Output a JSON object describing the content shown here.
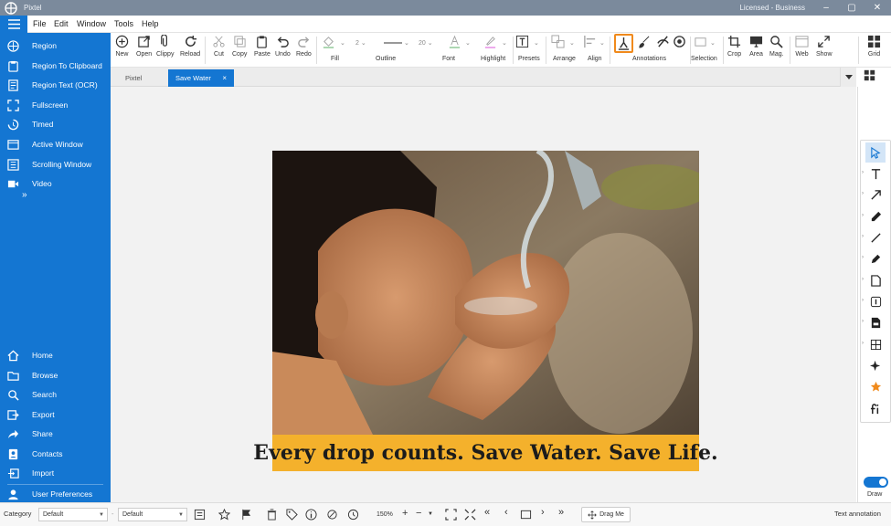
{
  "window": {
    "title": "Pixtel",
    "license": "Licensed - Business"
  },
  "menu": [
    "File",
    "Edit",
    "Window",
    "Tools",
    "Help"
  ],
  "sidebar": {
    "top": [
      {
        "label": "Region",
        "icon": "region-icon"
      },
      {
        "label": "Region To Clipboard",
        "icon": "clipboard-icon"
      },
      {
        "label": "Region Text (OCR)",
        "icon": "ocr-icon"
      },
      {
        "label": "Fullscreen",
        "icon": "fullscreen-icon"
      },
      {
        "label": "Timed",
        "icon": "timer-icon"
      },
      {
        "label": "Active Window",
        "icon": "window-icon"
      },
      {
        "label": "Scrolling Window",
        "icon": "scroll-window-icon"
      },
      {
        "label": "Video",
        "icon": "video-icon"
      }
    ],
    "more": "»",
    "bottom": [
      {
        "label": "Home",
        "icon": "home-icon"
      },
      {
        "label": "Browse",
        "icon": "folder-icon"
      },
      {
        "label": "Search",
        "icon": "search-icon"
      },
      {
        "label": "Export",
        "icon": "export-icon"
      },
      {
        "label": "Share",
        "icon": "share-icon"
      },
      {
        "label": "Contacts",
        "icon": "contacts-icon"
      },
      {
        "label": "Import",
        "icon": "import-icon"
      },
      {
        "label": "User Preferences",
        "icon": "user-icon"
      }
    ]
  },
  "toolbar": {
    "file": [
      "New",
      "Open",
      "Clippy",
      "Reload"
    ],
    "edit": [
      "Cut",
      "Copy",
      "Paste",
      "Undo",
      "Redo"
    ],
    "groups": {
      "fill": "Fill",
      "outline": "Outline",
      "font": "Font",
      "highlight": "Highlight",
      "presets": "Presets",
      "arrange": "Arrange",
      "align": "Align",
      "annotations": "Annotations",
      "selection": "Selection"
    },
    "outline_width": "2",
    "font_size": "20",
    "view": [
      "Crop",
      "Area",
      "Mag.",
      "Web",
      "Show",
      "Grid"
    ]
  },
  "tabs": [
    {
      "label": "Pixtel",
      "active": false
    },
    {
      "label": "Save Water",
      "active": true,
      "close": "×"
    }
  ],
  "canvas": {
    "caption": "Every drop counts. Save Water. Save Life.",
    "caption_color": "#f4b12c"
  },
  "draw_tools": [
    "select",
    "text",
    "arrow",
    "pen",
    "line",
    "marker",
    "note",
    "step",
    "stamp",
    "blur",
    "magic",
    "favorite",
    "fx"
  ],
  "draw_label": "Draw",
  "status": {
    "category_label": "Category",
    "category_value": "Default",
    "style_value": "Default",
    "zoom": "150%",
    "drag": "Drag Me",
    "mode": "Text annotation"
  },
  "accent": "#1476d2"
}
